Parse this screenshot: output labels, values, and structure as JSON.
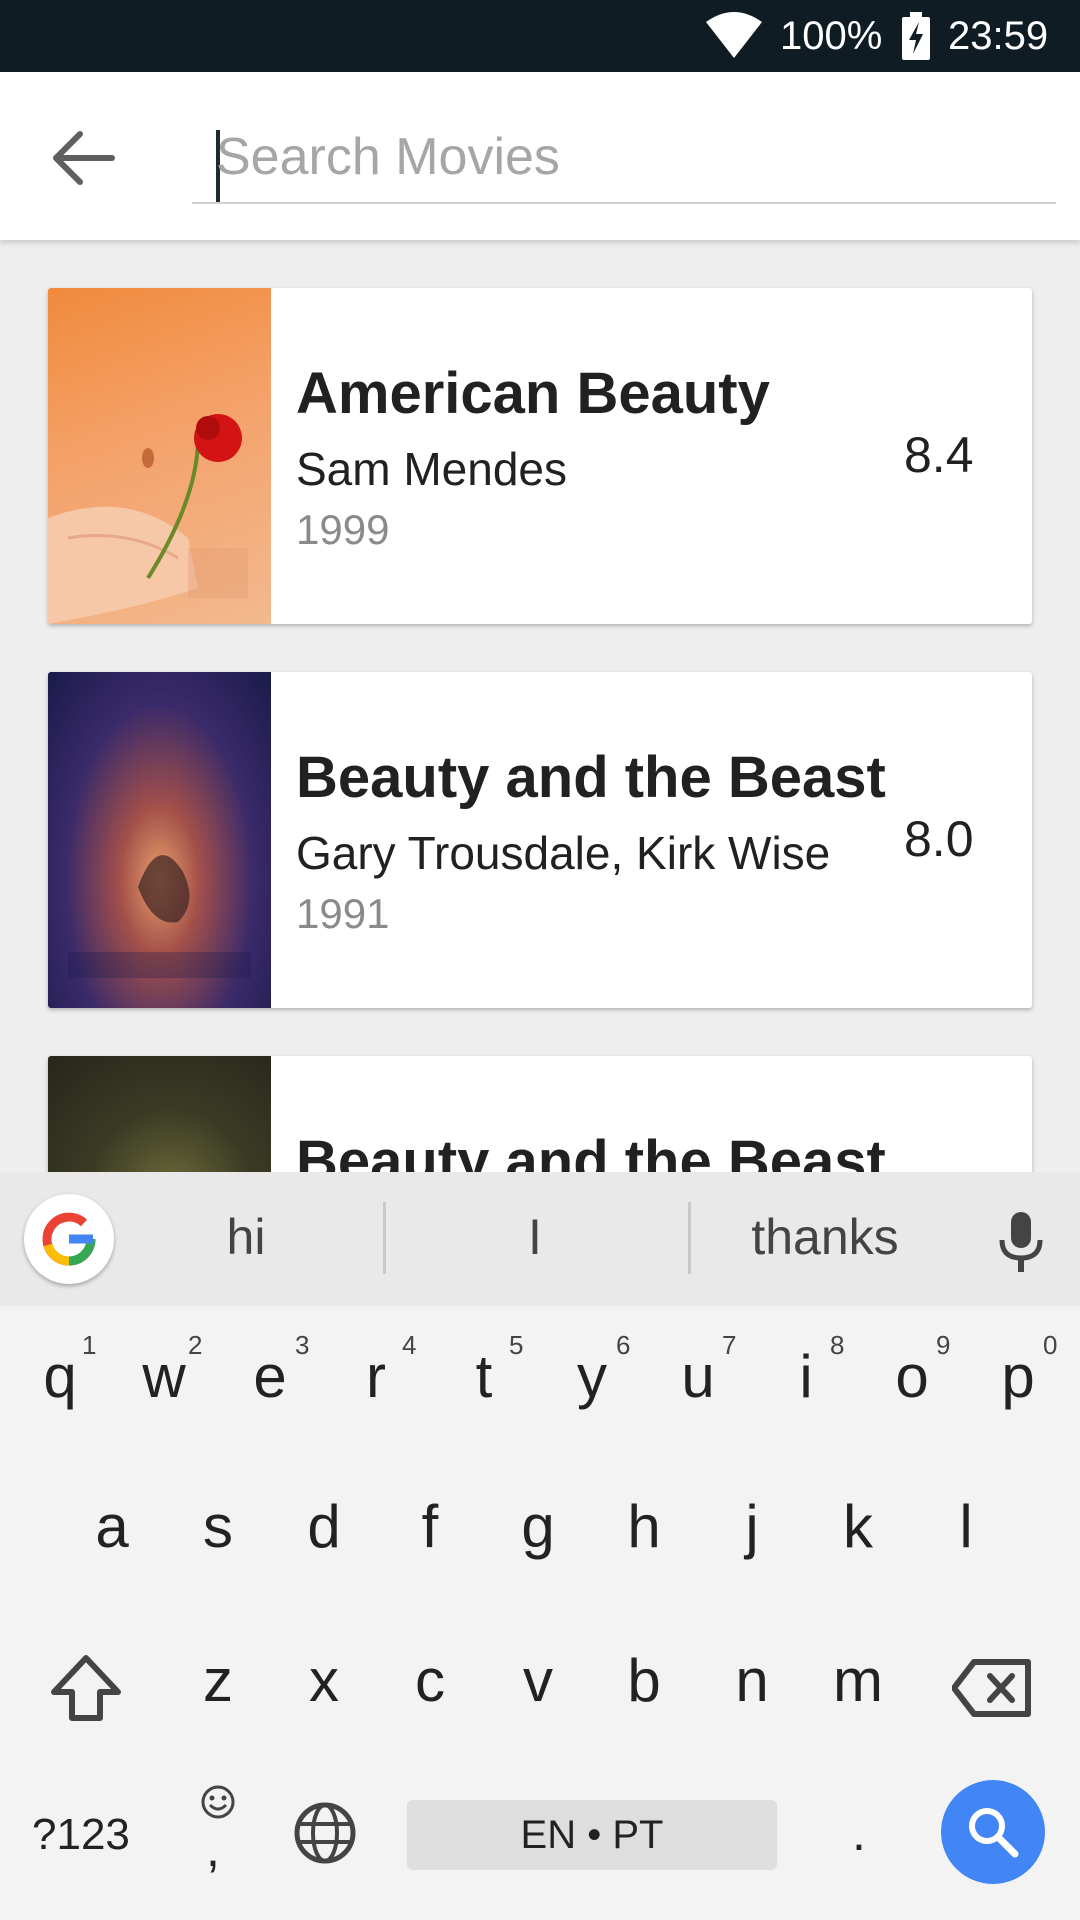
{
  "status_bar": {
    "battery_percent": "100%",
    "time": "23:59"
  },
  "app_bar": {
    "search_placeholder": "Search Movies",
    "search_value": ""
  },
  "movies": [
    {
      "title": "American Beauty",
      "director": "Sam Mendes",
      "year": "1999",
      "rating": "8.4"
    },
    {
      "title": "Beauty and the Beast",
      "director": "Gary Trousdale, Kirk Wise",
      "year": "1991",
      "rating": "8.0"
    },
    {
      "title": "Beauty and the Beast",
      "director": "",
      "year": "",
      "rating": ""
    }
  ],
  "keyboard": {
    "suggestions": [
      "hi",
      "I",
      "thanks"
    ],
    "row1": [
      "q",
      "w",
      "e",
      "r",
      "t",
      "y",
      "u",
      "i",
      "o",
      "p"
    ],
    "row1_hints": [
      "1",
      "2",
      "3",
      "4",
      "5",
      "6",
      "7",
      "8",
      "9",
      "0"
    ],
    "row2": [
      "a",
      "s",
      "d",
      "f",
      "g",
      "h",
      "j",
      "k",
      "l"
    ],
    "row3": [
      "z",
      "x",
      "c",
      "v",
      "b",
      "n",
      "m"
    ],
    "symbols_label": "?123",
    "space_label": "EN • PT",
    "period_label": ".",
    "emoji_comma_label": ","
  },
  "colors": {
    "status_bar": "#0f1c24",
    "accent_blue": "#4285f4"
  }
}
